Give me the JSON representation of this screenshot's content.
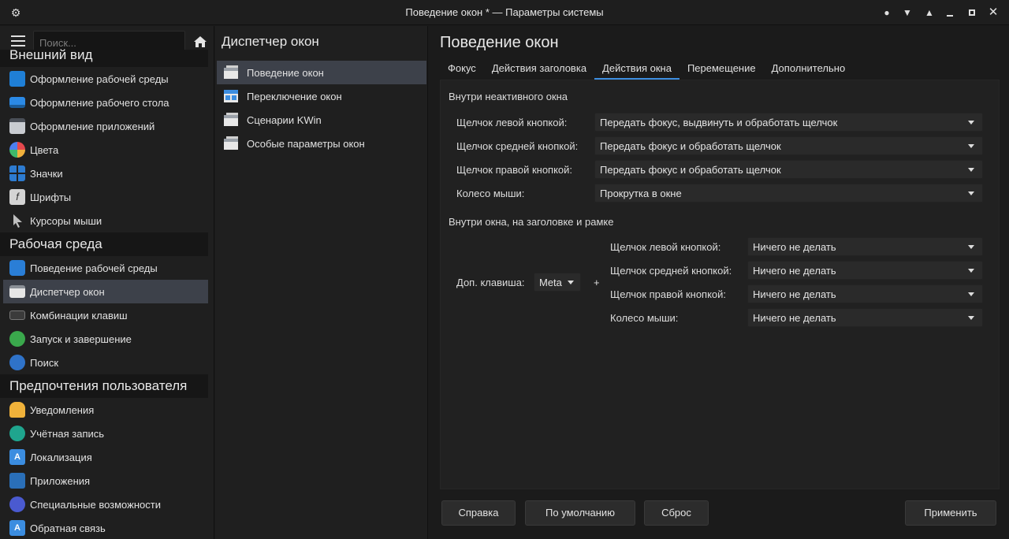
{
  "window": {
    "title": "Поведение окон * — Параметры системы"
  },
  "sidebar": {
    "search_placeholder": "Поиск...",
    "sections": [
      {
        "title": "Внешний вид",
        "items": [
          {
            "label": "Оформление рабочей среды",
            "icon": "plasma-style-icon"
          },
          {
            "label": "Оформление рабочего стола",
            "icon": "desktop-theme-icon"
          },
          {
            "label": "Оформление приложений",
            "icon": "app-style-icon"
          },
          {
            "label": "Цвета",
            "icon": "colors-icon"
          },
          {
            "label": "Значки",
            "icon": "icons-icon"
          },
          {
            "label": "Шрифты",
            "icon": "fonts-icon"
          },
          {
            "label": "Курсоры мыши",
            "icon": "cursor-icon"
          }
        ]
      },
      {
        "title": "Рабочая среда",
        "items": [
          {
            "label": "Поведение рабочей среды",
            "icon": "workspace-behavior-icon"
          },
          {
            "label": "Диспетчер окон",
            "icon": "window-manager-icon"
          },
          {
            "label": "Комбинации клавиш",
            "icon": "keyboard-icon"
          },
          {
            "label": "Запуск и завершение",
            "icon": "startup-icon"
          },
          {
            "label": "Поиск",
            "icon": "search-icon"
          }
        ]
      },
      {
        "title": "Предпочтения пользователя",
        "items": [
          {
            "label": "Уведомления",
            "icon": "bell-icon"
          },
          {
            "label": "Учётная запись",
            "icon": "user-icon"
          },
          {
            "label": "Локализация",
            "icon": "locale-icon"
          },
          {
            "label": "Приложения",
            "icon": "applications-icon"
          },
          {
            "label": "Специальные возможности",
            "icon": "accessibility-icon"
          },
          {
            "label": "Обратная связь",
            "icon": "feedback-icon"
          }
        ]
      }
    ]
  },
  "midpanel": {
    "title": "Диспетчер окон",
    "items": [
      {
        "label": "Поведение окон"
      },
      {
        "label": "Переключение окон"
      },
      {
        "label": "Сценарии KWin"
      },
      {
        "label": "Особые параметры окон"
      }
    ]
  },
  "main": {
    "title": "Поведение окон",
    "tabs": [
      "Фокус",
      "Действия заголовка",
      "Действия окна",
      "Перемещение",
      "Дополнительно"
    ],
    "inactive": {
      "title": "Внутри неактивного окна",
      "rows": [
        {
          "label": "Щелчок левой кнопкой:",
          "value": "Передать фокус, выдвинуть и обработать щелчок"
        },
        {
          "label": "Щелчок средней кнопкой:",
          "value": "Передать фокус и обработать щелчок"
        },
        {
          "label": "Щелчок правой кнопкой:",
          "value": "Передать фокус и обработать щелчок"
        },
        {
          "label": "Колесо мыши:",
          "value": "Прокрутка в окне"
        }
      ]
    },
    "inside": {
      "title": "Внутри окна, на заголовке и рамке",
      "modifier_label": "Доп. клавиша:",
      "modifier_value": "Meta",
      "plus": "+",
      "rows": [
        {
          "label": "Щелчок левой кнопкой:",
          "value": "Ничего не делать"
        },
        {
          "label": "Щелчок средней кнопкой:",
          "value": "Ничего не делать"
        },
        {
          "label": "Щелчок правой кнопкой:",
          "value": "Ничего не делать"
        },
        {
          "label": "Колесо мыши:",
          "value": "Ничего не делать"
        }
      ]
    },
    "buttons": {
      "help": "Справка",
      "defaults": "По умолчанию",
      "reset": "Сброс",
      "apply": "Применить"
    }
  }
}
